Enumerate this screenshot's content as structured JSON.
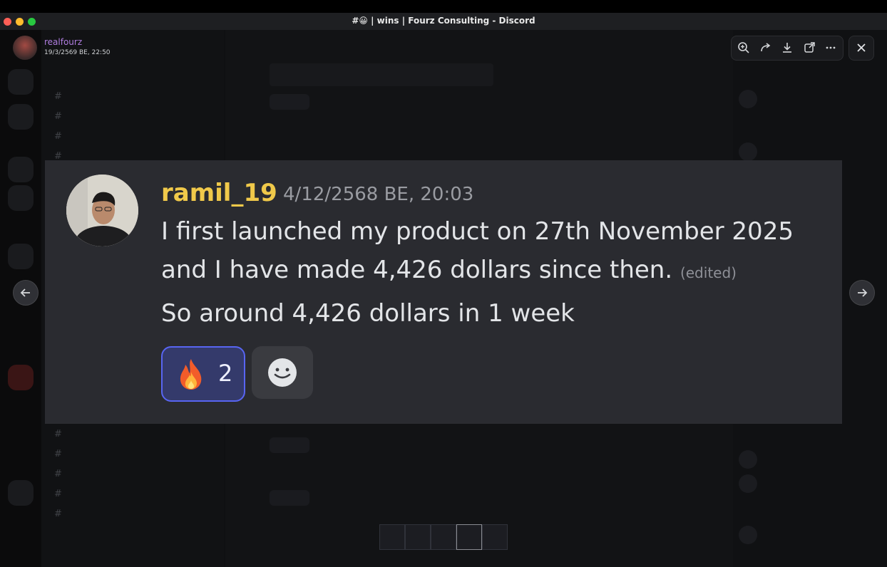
{
  "window": {
    "title": "#😀 | wins | Fourz Consulting - Discord"
  },
  "viewer": {
    "uploader_name": "realfourz",
    "uploader_date": "19/3/2569 BE, 22:50"
  },
  "toolbar": {
    "icons": [
      "zoom-in-icon",
      "forward-icon",
      "download-icon",
      "open-external-icon",
      "more-icon"
    ],
    "close_icon": "close-icon"
  },
  "message": {
    "username": "ramil_19",
    "timestamp": "4/12/2568 BE, 20:03",
    "line1": "I first launched my product on 27th November 2025",
    "line2": "and I have made 4,426 dollars since then.",
    "edited": "(edited)",
    "line3": "So around 4,426 dollars in 1 week",
    "reactions": [
      {
        "emoji": "fire-icon",
        "count": "2",
        "selected": true
      },
      {
        "emoji": "add-reaction-icon",
        "count": ""
      }
    ]
  },
  "colors": {
    "username": "#f0c94a",
    "accent": "#5865f2",
    "card_bg": "#2a2b30"
  }
}
